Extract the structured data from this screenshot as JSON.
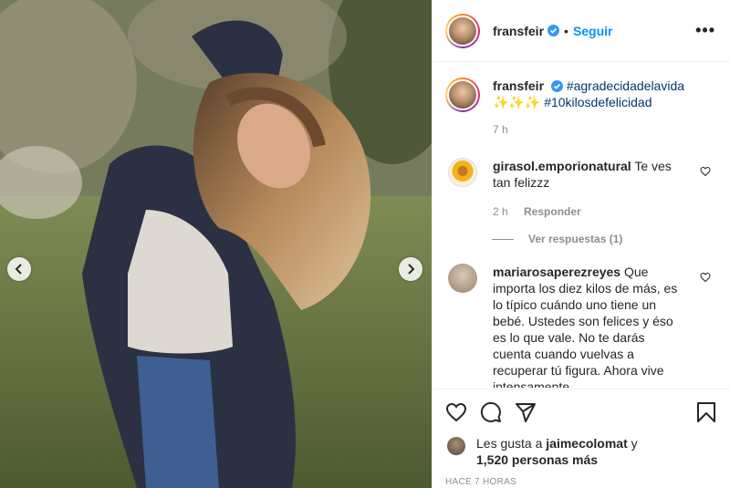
{
  "post": {
    "image_alt": "Mujer con el cabello en movimiento en un jardín",
    "prev_icon": "chevron-left-icon",
    "next_icon": "chevron-right-icon"
  },
  "header": {
    "username": "fransfeir",
    "separator": "•",
    "follow_label": "Seguir",
    "more_label": "•••"
  },
  "caption": {
    "username": "fransfeir",
    "hashtag1": "#agradecidadelavida",
    "emojis": "✨✨✨",
    "hashtag2": "#10kilosdefelicidad",
    "time": "7 h"
  },
  "comments": [
    {
      "username": "girasol.emporionatural",
      "text": "Te ves tan felizzz",
      "time": "2 h",
      "reply_label": "Responder",
      "view_replies": "Ver respuestas (1)"
    },
    {
      "username": "mariarosaperezreyes",
      "text": "Que importa los diez kilos de más, es lo típico cuándo uno tiene un bebé. Ustedes son felices y éso es lo que vale. No te darás cuenta cuando vuelvas a recuperar tú figura. Ahora vive intensamente"
    }
  ],
  "likes": {
    "prefix": "Les gusta a",
    "user": "jaimecolomat",
    "connector": "y",
    "others": "1,520 personas más"
  },
  "timestamp": "HACE 7 HORAS",
  "colors": {
    "accent": "#0095f6",
    "hashtag": "#00376b",
    "muted": "#8e8e8e"
  }
}
